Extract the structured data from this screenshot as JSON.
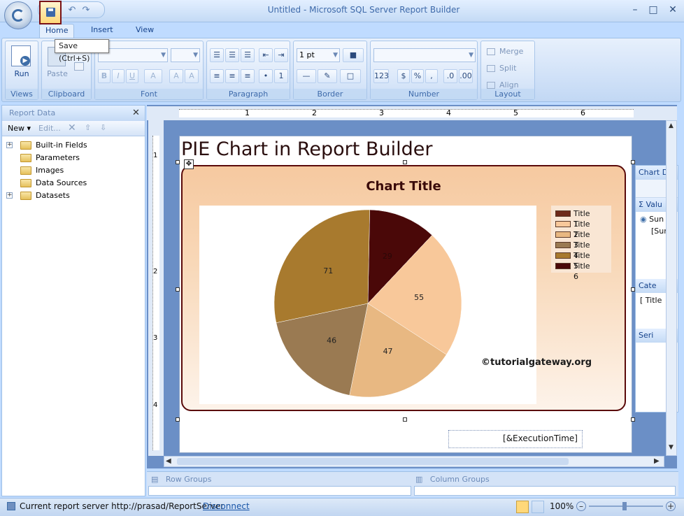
{
  "window": {
    "title": "Untitled - Microsoft SQL Server Report Builder"
  },
  "tooltip": "Save (Ctrl+S)",
  "tabs": [
    "Home",
    "Insert",
    "View"
  ],
  "ribbon": {
    "groups": [
      "Views",
      "Clipboard",
      "Font",
      "Paragraph",
      "Border",
      "Number",
      "Layout"
    ],
    "run_label": "Run",
    "paste_label": "Paste",
    "border_width": "1 pt",
    "merge_label": "Merge",
    "split_label": "Split",
    "align_label": "Align"
  },
  "report_data": {
    "header": "Report Data",
    "new_label": "New",
    "edit_label": "Edit...",
    "tree": [
      {
        "label": "Built-in Fields",
        "expandable": true
      },
      {
        "label": "Parameters",
        "expandable": false
      },
      {
        "label": "Images",
        "expandable": false
      },
      {
        "label": "Data Sources",
        "expandable": false
      },
      {
        "label": "Datasets",
        "expandable": true
      }
    ]
  },
  "ruler": {
    "top_marks": [
      "1",
      "2",
      "3",
      "4",
      "5",
      "6"
    ],
    "left_marks": [
      "1",
      "2",
      "3",
      "4"
    ]
  },
  "report": {
    "title": "PIE Chart in Report Builder",
    "execution_time": "[&ExecutionTime]",
    "watermark": "©tutorialgateway.org"
  },
  "chart_data": {
    "type": "pie",
    "title": "Chart Title",
    "legend_position": "top-right",
    "categories": [
      "Title 1",
      "Title 2",
      "Title 3",
      "Title 4",
      "Title 5",
      "Title 6"
    ],
    "values": [
      null,
      55,
      47,
      46,
      71,
      29
    ],
    "colors": [
      "#6e2a1a",
      "#f8c89a",
      "#e8b882",
      "#9a7a52",
      "#a87a2e",
      "#4a0808"
    ]
  },
  "side_panel": {
    "chart_data_label": "Chart D",
    "values_label": "Valu",
    "sum_label": "Sun",
    "sum_field": "[Sur",
    "category_label": "Cate",
    "category_item": "Title",
    "series_label": "Seri"
  },
  "groups": {
    "row": "Row Groups",
    "column": "Column Groups"
  },
  "status": {
    "server_text": "Current report server http://prasad/ReportServer",
    "disconnect": "Disconnect",
    "zoom": "100%"
  }
}
